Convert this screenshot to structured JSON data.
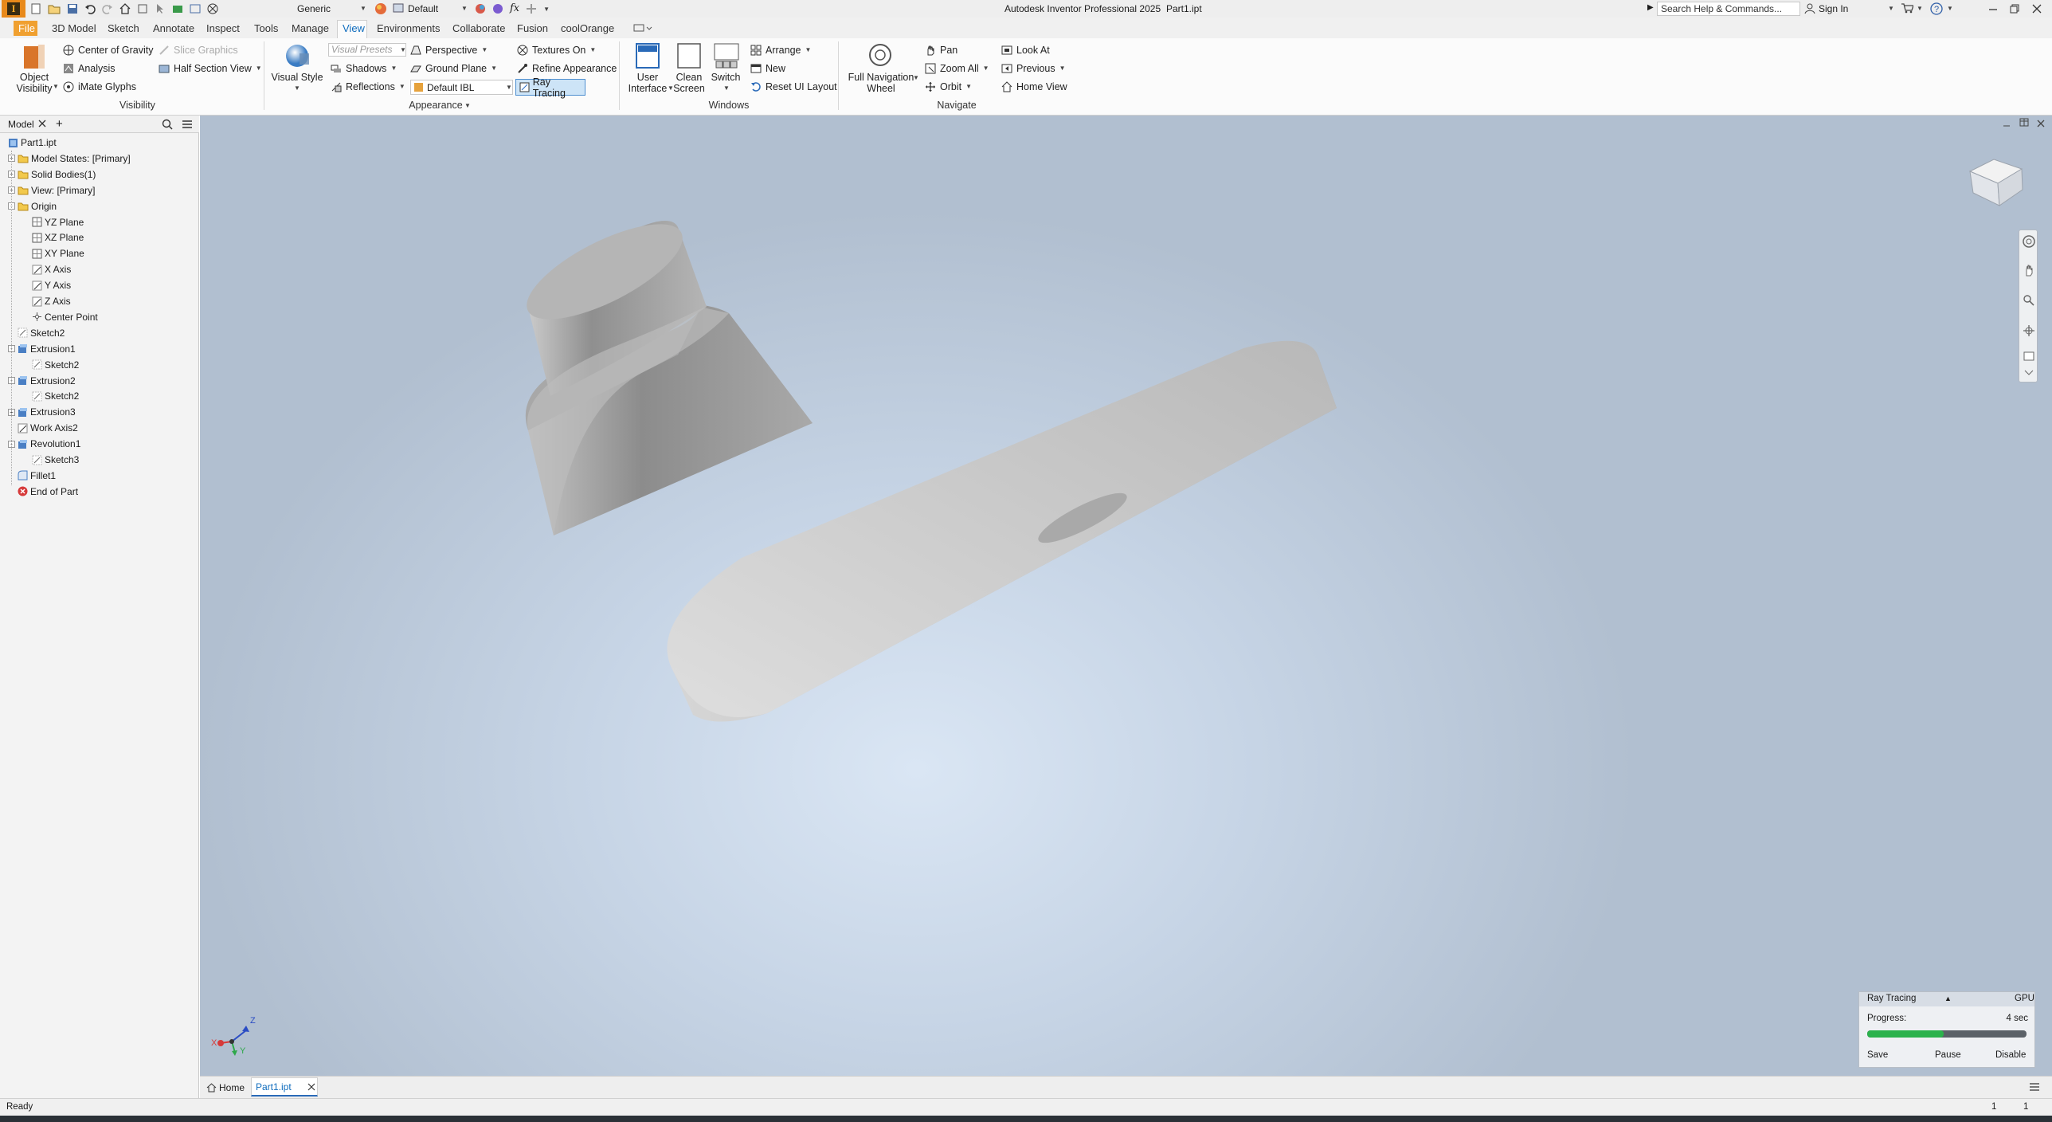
{
  "app": {
    "title": "Autodesk Inventor Professional 2025",
    "document": "Part1.ipt",
    "material": "Generic",
    "appearance": "Default",
    "search_placeholder": "Search Help & Commands...",
    "sign_in": "Sign In"
  },
  "tabs": [
    "File",
    "3D Model",
    "Sketch",
    "Annotate",
    "Inspect",
    "Tools",
    "Manage",
    "View",
    "Environments",
    "Collaborate",
    "Fusion",
    "coolOrange"
  ],
  "active_tab": "View",
  "ribbon": {
    "visibility": {
      "object_visibility_line1": "Object",
      "object_visibility_line2": "Visibility",
      "center_of_gravity": "Center of Gravity",
      "slice_graphics": "Slice Graphics",
      "analysis": "Analysis",
      "half_section_view": "Half Section View",
      "imate_glyphs": "iMate Glyphs",
      "group_label": "Visibility"
    },
    "appearance": {
      "visual_style": "Visual Style",
      "visual_presets": "Visual Presets",
      "perspective": "Perspective",
      "textures_on": "Textures On",
      "shadows": "Shadows",
      "ground_plane": "Ground Plane",
      "refine_appearance": "Refine Appearance",
      "reflections": "Reflections",
      "default_ibl": "Default IBL",
      "ray_tracing": "Ray Tracing",
      "group_label": "Appearance"
    },
    "windows": {
      "user_interface_line1": "User",
      "user_interface_line2": "Interface",
      "clean_screen_line1": "Clean",
      "clean_screen_line2": "Screen",
      "switch": "Switch",
      "arrange": "Arrange",
      "new": "New",
      "reset_ui_layout": "Reset UI Layout",
      "group_label": "Windows"
    },
    "navigate": {
      "full_nav_wheel_line1": "Full Navigation",
      "full_nav_wheel_line2": "Wheel",
      "pan": "Pan",
      "zoom_all": "Zoom All",
      "orbit": "Orbit",
      "look_at": "Look At",
      "previous": "Previous",
      "home_view": "Home View",
      "group_label": "Navigate"
    }
  },
  "browser": {
    "tab_label": "Model",
    "items": [
      {
        "label": "Part1.ipt",
        "indent": 0,
        "icon": "part",
        "exp": ""
      },
      {
        "label": "Model States: [Primary]",
        "indent": 1,
        "icon": "folder",
        "exp": "+"
      },
      {
        "label": "Solid Bodies(1)",
        "indent": 1,
        "icon": "folder",
        "exp": "+"
      },
      {
        "label": "View: [Primary]",
        "indent": 1,
        "icon": "folder",
        "exp": "+"
      },
      {
        "label": "Origin",
        "indent": 1,
        "icon": "folder",
        "exp": "-"
      },
      {
        "label": "YZ Plane",
        "indent": 2,
        "icon": "plane",
        "exp": ""
      },
      {
        "label": "XZ Plane",
        "indent": 2,
        "icon": "plane",
        "exp": ""
      },
      {
        "label": "XY Plane",
        "indent": 2,
        "icon": "plane",
        "exp": ""
      },
      {
        "label": "X Axis",
        "indent": 2,
        "icon": "axis",
        "exp": ""
      },
      {
        "label": "Y Axis",
        "indent": 2,
        "icon": "axis",
        "exp": ""
      },
      {
        "label": "Z Axis",
        "indent": 2,
        "icon": "axis",
        "exp": ""
      },
      {
        "label": "Center Point",
        "indent": 2,
        "icon": "point",
        "exp": ""
      },
      {
        "label": "Sketch2",
        "indent": 1,
        "icon": "sketch",
        "exp": ""
      },
      {
        "label": "Extrusion1",
        "indent": 1,
        "icon": "feature",
        "exp": "-"
      },
      {
        "label": "Sketch2",
        "indent": 2,
        "icon": "sketch",
        "exp": ""
      },
      {
        "label": "Extrusion2",
        "indent": 1,
        "icon": "feature",
        "exp": "-"
      },
      {
        "label": "Sketch2",
        "indent": 2,
        "icon": "sketch",
        "exp": ""
      },
      {
        "label": "Extrusion3",
        "indent": 1,
        "icon": "feature",
        "exp": "+"
      },
      {
        "label": "Work Axis2",
        "indent": 1,
        "icon": "axis",
        "exp": ""
      },
      {
        "label": "Revolution1",
        "indent": 1,
        "icon": "feature",
        "exp": "-"
      },
      {
        "label": "Sketch3",
        "indent": 2,
        "icon": "sketch",
        "exp": ""
      },
      {
        "label": "Fillet1",
        "indent": 1,
        "icon": "fillet",
        "exp": ""
      },
      {
        "label": "End of Part",
        "indent": 1,
        "icon": "end",
        "exp": ""
      }
    ]
  },
  "triad": {
    "x": "X",
    "y": "Y",
    "z": "Z"
  },
  "ray_tracing_panel": {
    "title": "Ray Tracing",
    "mode": "GPU",
    "progress_label": "Progress:",
    "time": "4 sec",
    "progress": 0.48,
    "save": "Save",
    "pause": "Pause",
    "disable": "Disable"
  },
  "doc_tabs": {
    "home": "Home",
    "part": "Part1.ipt"
  },
  "status": {
    "text": "Ready",
    "count1": "1",
    "count2": "1"
  },
  "colors": {
    "accent": "#e8891a",
    "file_tab": "#f0a030",
    "active_tab_text": "#0f6cbd",
    "progress": "#2bb24c"
  }
}
